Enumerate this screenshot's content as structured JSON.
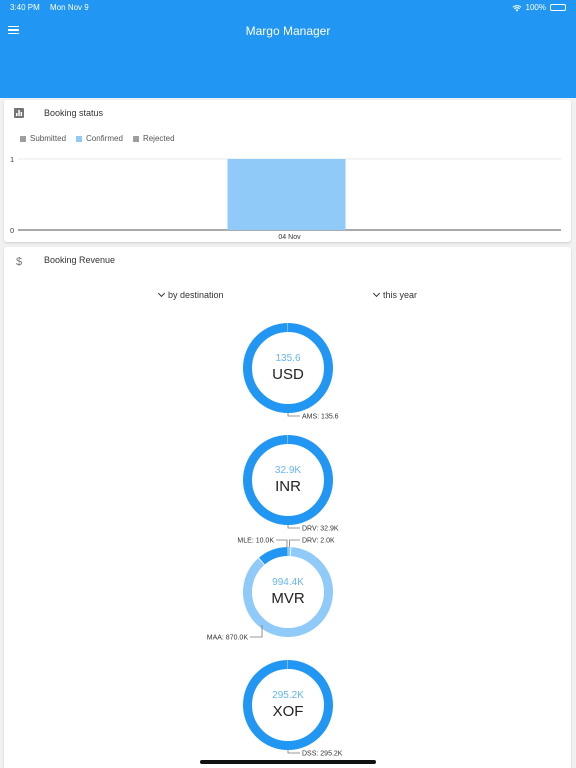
{
  "statusbar": {
    "time": "3:40 PM",
    "date": "Mon Nov 9",
    "battery": "100%"
  },
  "appbar": {
    "title": "Margo Manager"
  },
  "booking_status": {
    "title": "Booking status",
    "legend": [
      {
        "label": "Submitted",
        "color": "#9e9e9e"
      },
      {
        "label": "Confirmed",
        "color": "#90caf9"
      },
      {
        "label": "Rejected",
        "color": "#9e9e9e"
      }
    ]
  },
  "chart_data": {
    "type": "bar",
    "categories": [
      "04 Nov"
    ],
    "series": [
      {
        "name": "Submitted",
        "values": [
          0
        ]
      },
      {
        "name": "Confirmed",
        "values": [
          1
        ]
      },
      {
        "name": "Rejected",
        "values": [
          0
        ]
      }
    ],
    "ylim": [
      0,
      1
    ],
    "yticks": [
      "0",
      "1"
    ],
    "grid": true,
    "legend_position": "top-left"
  },
  "revenue": {
    "title": "Booking Revenue",
    "group_by": "by destination",
    "period": "this year",
    "donuts": [
      {
        "total": "135.6",
        "currency": "USD",
        "segments": [
          {
            "label": "AMS: 135.6",
            "value": 135.6,
            "color": "#2196f3"
          }
        ]
      },
      {
        "total": "32.9K",
        "currency": "INR",
        "segments": [
          {
            "label": "DRV: 32.9K",
            "value": 32.9,
            "color": "#2196f3"
          }
        ]
      },
      {
        "total": "994.4K",
        "currency": "MVR",
        "segments": [
          {
            "label": "DRV: 2.0K",
            "value": 2.0,
            "color": "#2196f3"
          },
          {
            "label": "MLE: 10.0K",
            "value": 10.0,
            "color": "#90caf9"
          },
          {
            "label": "MAA: 870.0K",
            "value": 870.0,
            "color": "#90caf9"
          },
          {
            "label": "",
            "value": 112.4,
            "color": "#2196f3"
          }
        ]
      },
      {
        "total": "295.2K",
        "currency": "XOF",
        "segments": [
          {
            "label": "DSS: 295.2K",
            "value": 295.2,
            "color": "#2196f3"
          }
        ]
      }
    ]
  }
}
